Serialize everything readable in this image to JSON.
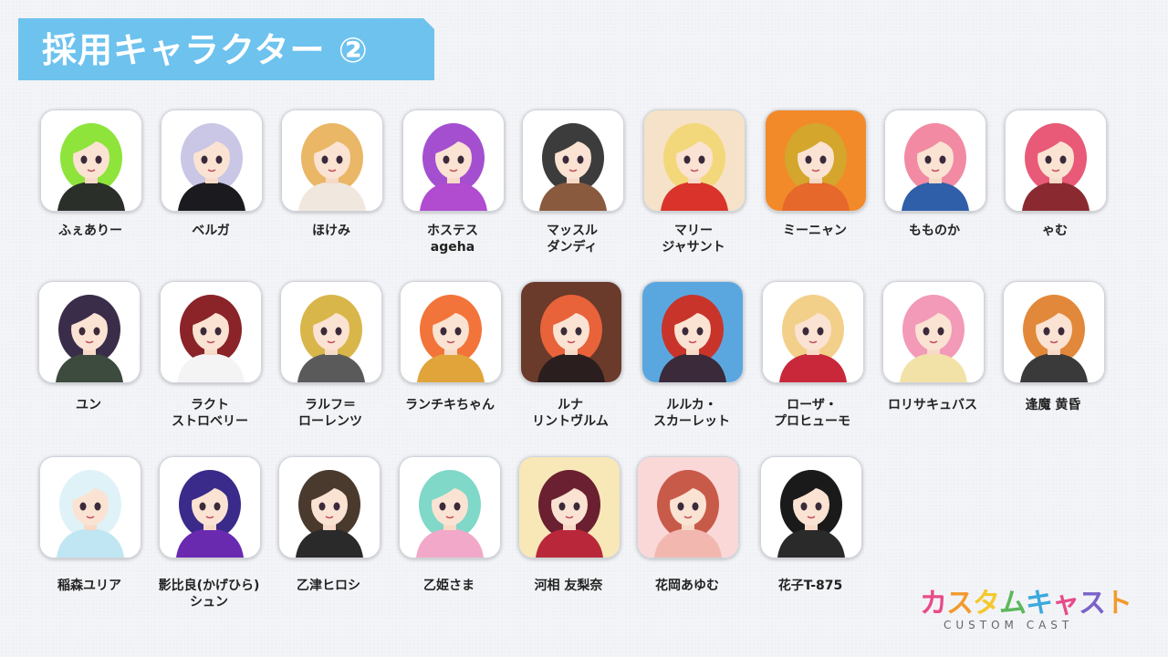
{
  "title": "採用キャラクター ②",
  "colors": {
    "banner": "#6dc2ee",
    "title_text": "#ffffff"
  },
  "characters": [
    {
      "name_line1": "ふぇありー",
      "name_line2": "",
      "hair": "#8ee43a",
      "bg": "#ffffff",
      "cloth": "#2b2f2a"
    },
    {
      "name_line1": "ベルガ",
      "name_line2": "",
      "hair": "#c9c6e6",
      "bg": "#ffffff",
      "cloth": "#1b1b1f"
    },
    {
      "name_line1": "ほけみ",
      "name_line2": "",
      "hair": "#e9b766",
      "bg": "#ffffff",
      "cloth": "#f0e8de"
    },
    {
      "name_line1": "ホステス",
      "name_line2": "ageha",
      "hair": "#a44fd0",
      "bg": "#ffffff",
      "cloth": "#b14bd0"
    },
    {
      "name_line1": "マッスル",
      "name_line2": "ダンディ",
      "hair": "#3c3c3c",
      "bg": "#ffffff",
      "cloth": "#8a5a3e"
    },
    {
      "name_line1": "マリー",
      "name_line2": "ジャサント",
      "hair": "#f2d87a",
      "bg": "#f6e2c8",
      "cloth": "#d9332b"
    },
    {
      "name_line1": "ミーニャン",
      "name_line2": "",
      "hair": "#d4a62c",
      "bg": "#f28a2a",
      "cloth": "#e6682a"
    },
    {
      "name_line1": "ももの か",
      "name_line2": "",
      "hair": "#f28aa3",
      "bg": "#ffffff",
      "cloth": "#2f5fa8"
    },
    {
      "name_line1": "ゃむ",
      "name_line2": "",
      "hair": "#e85a78",
      "bg": "#ffffff",
      "cloth": "#8a2a30"
    },
    {
      "name_line1": "ユン",
      "name_line2": "",
      "hair": "#3a2d4a",
      "bg": "#ffffff",
      "cloth": "#3d4a3e"
    },
    {
      "name_line1": "ラクト",
      "name_line2": "ストロベリー",
      "hair": "#8a2428",
      "bg": "#ffffff",
      "cloth": "#f4f4f4"
    },
    {
      "name_line1": "ラルフ＝",
      "name_line2": "ローレンツ",
      "hair": "#d8b64a",
      "bg": "#ffffff",
      "cloth": "#5a5a5a"
    },
    {
      "name_line1": "ランチキちゃん",
      "name_line2": "",
      "hair": "#f2743a",
      "bg": "#ffffff",
      "cloth": "#e0a43a"
    },
    {
      "name_line1": "ルナ",
      "name_line2": "リントヴルム",
      "hair": "#e8623a",
      "bg": "#6a3a2a",
      "cloth": "#2a1e1e"
    },
    {
      "name_line1": "ルルカ・",
      "name_line2": "スカーレット",
      "hair": "#c8342a",
      "bg": "#5aa7e0",
      "cloth": "#3a2a3a"
    },
    {
      "name_line1": "ローザ・",
      "name_line2": "プロヒューモ",
      "hair": "#f2d08a",
      "bg": "#ffffff",
      "cloth": "#c8283a"
    },
    {
      "name_line1": "ロリサキュバス",
      "name_line2": "",
      "hair": "#f29ab8",
      "bg": "#ffffff",
      "cloth": "#f2e2a8"
    },
    {
      "name_line1": "逢魔 黄昏",
      "name_line2": "",
      "hair": "#e2883a",
      "bg": "#ffffff",
      "cloth": "#3a3a3a"
    },
    {
      "name_line1": "稲森ユリア",
      "name_line2": "",
      "hair": "#dff2f8",
      "bg": "#ffffff",
      "cloth": "#bfe6f2"
    },
    {
      "name_line1": "影比良(かげひら)",
      "name_line2": "シュン",
      "hair": "#3a2a8a",
      "bg": "#ffffff",
      "cloth": "#6a2ab0"
    },
    {
      "name_line1": "乙津ヒロシ",
      "name_line2": "",
      "hair": "#4a3a2e",
      "bg": "#ffffff",
      "cloth": "#2a2a2a"
    },
    {
      "name_line1": "乙姫さま",
      "name_line2": "",
      "hair": "#7fd8c8",
      "bg": "#ffffff",
      "cloth": "#f2a8c8"
    },
    {
      "name_line1": "河相 友梨奈",
      "name_line2": "",
      "hair": "#6a2030",
      "bg": "#f8e8b8",
      "cloth": "#b8283a"
    },
    {
      "name_line1": "花岡あゆむ",
      "name_line2": "",
      "hair": "#c85a4a",
      "bg": "#fbd8d8",
      "cloth": "#f2b8b0"
    },
    {
      "name_line1": "花子T-875",
      "name_line2": "",
      "hair": "#1a1a1a",
      "bg": "#ffffff",
      "cloth": "#2a2a2a"
    }
  ],
  "logo": {
    "main": [
      "カ",
      "ス",
      "タ",
      "ム",
      "キ",
      "ャ",
      "ス",
      "ト"
    ],
    "sub": "CUSTOM CAST"
  }
}
